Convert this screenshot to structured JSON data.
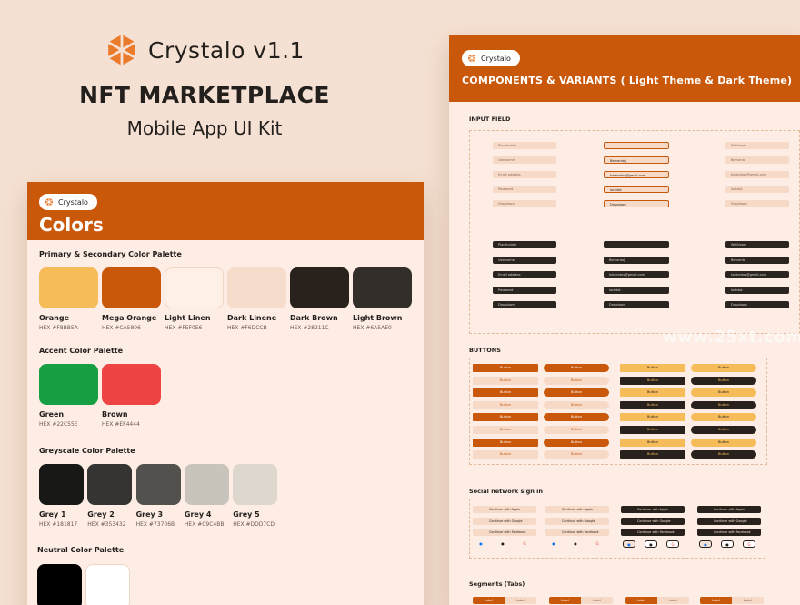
{
  "hero": {
    "brand": "Crystalo v1.1",
    "title": "NFT MARKETPLACE",
    "subtitle": "Mobile App UI Kit"
  },
  "colors_board": {
    "pill": "Crystalo",
    "title": "Colors",
    "primary_title": "Primary & Secondary Color Palette",
    "primary": [
      {
        "name": "Orange",
        "hex": "HEX #F8BB5A",
        "color": "#F7BC5A"
      },
      {
        "name": "Mega Orange",
        "hex": "HEX #CA5806",
        "color": "#C9580A"
      },
      {
        "name": "Light Linen",
        "hex": "HEX #FEF0E6",
        "color": "#FEF0E6"
      },
      {
        "name": "Dark Linene",
        "hex": "HEX #F6DCCB",
        "color": "#F5DCCB"
      },
      {
        "name": "Dark Brown",
        "hex": "HEX #28211C",
        "color": "#28211C"
      },
      {
        "name": "Light Brown",
        "hex": "HEX #6A5AE0",
        "color": "#342E2B"
      }
    ],
    "accent_title": "Accent Color Palette",
    "accent": [
      {
        "name": "Green",
        "hex": "HEX #22C55E",
        "color": "#16A043"
      },
      {
        "name": "Brown",
        "hex": "HEX #EF4444",
        "color": "#EF4444"
      }
    ],
    "grey_title": "Greyscale Color Palette",
    "grey": [
      {
        "name": "Grey 1",
        "hex": "HEX #181817",
        "color": "#181817"
      },
      {
        "name": "Grey 2",
        "hex": "HEX #353432",
        "color": "#353432"
      },
      {
        "name": "Grey 3",
        "hex": "HEX #73706B",
        "color": "#53514D"
      },
      {
        "name": "Grey 4",
        "hex": "HEX #C9C4BB",
        "color": "#C9C4BB"
      },
      {
        "name": "Grey 5",
        "hex": "HEX #DDD7CD",
        "color": "#DDD7CD"
      }
    ],
    "neutral_title": "Neutral Color Palette",
    "neutral": [
      {
        "color": "#000000"
      },
      {
        "color": "#FFFFFF"
      }
    ]
  },
  "components_board": {
    "pill": "Crystalo",
    "title": "COMPONENTS & VARIANTS ( Light Theme & Dark Theme)",
    "input_title": "INPUT FIELD",
    "inputs": [
      "Placeholder",
      "Username",
      "Email address",
      "Password",
      "Dropdown"
    ],
    "inputs_filled": [
      "",
      "Bernardo||",
      "tobenidos@gmail.com",
      "lockdot",
      "Dropdown"
    ],
    "inputs_right": [
      "Wellbeam",
      "Bernardo",
      "tobenidos@gmail.com",
      "lockdot",
      "Dropdown"
    ],
    "buttons_title": "BUTTONS",
    "button_label": "Button",
    "social_title": "Social network sign in",
    "social": [
      "Continue with Apple",
      "Continue with Google",
      "Continue with Facebook"
    ],
    "segments_title": "Segments (Tabs)",
    "segment_labels": [
      "Label",
      "Label"
    ]
  },
  "watermark": "www.25xt.com",
  "colors": {
    "accent": "#C9580A",
    "board_bg": "#FDEDE4",
    "page_bg": "#F5E1D3"
  }
}
